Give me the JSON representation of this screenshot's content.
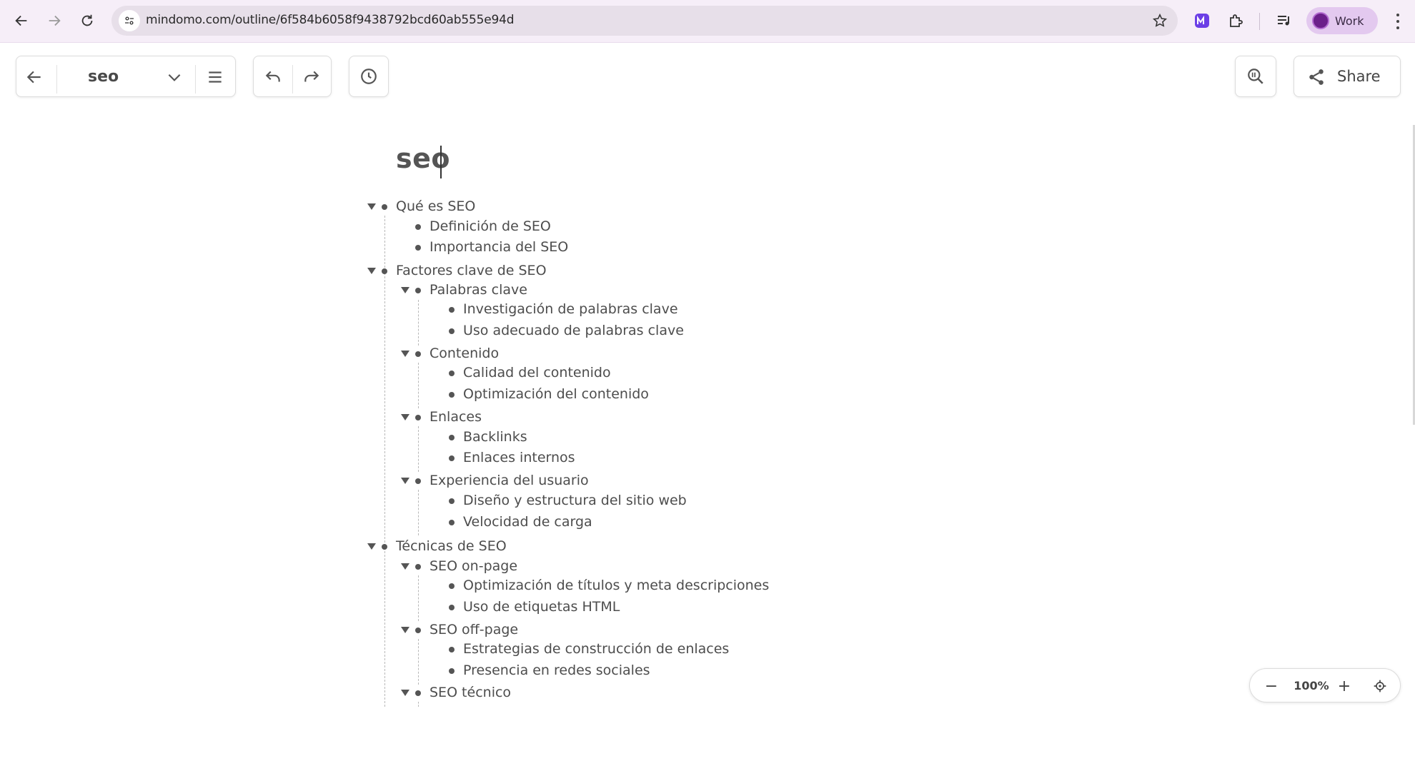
{
  "browser": {
    "url": "mindomo.com/outline/6f584b6058f9438792bcd60ab555e94d",
    "profile_label": "Work"
  },
  "toolbar": {
    "map_title": "seo",
    "share_label": "Share"
  },
  "outline": {
    "title": "seo",
    "items": [
      {
        "text": "Qué es SEO"
      },
      {
        "text": "Definición de SEO"
      },
      {
        "text": "Importancia del SEO"
      },
      {
        "text": "Factores clave de SEO"
      },
      {
        "text": "Palabras clave"
      },
      {
        "text": "Investigación de palabras clave"
      },
      {
        "text": "Uso adecuado de palabras clave"
      },
      {
        "text": "Contenido"
      },
      {
        "text": "Calidad del contenido"
      },
      {
        "text": "Optimización del contenido"
      },
      {
        "text": "Enlaces"
      },
      {
        "text": "Backlinks"
      },
      {
        "text": "Enlaces internos"
      },
      {
        "text": "Experiencia del usuario"
      },
      {
        "text": "Diseño y estructura del sitio web"
      },
      {
        "text": "Velocidad de carga"
      },
      {
        "text": "Técnicas de SEO"
      },
      {
        "text": "SEO on-page"
      },
      {
        "text": "Optimización de títulos y meta descripciones"
      },
      {
        "text": "Uso de etiquetas HTML"
      },
      {
        "text": "SEO off-page"
      },
      {
        "text": "Estrategias de construcción de enlaces"
      },
      {
        "text": "Presencia en redes sociales"
      },
      {
        "text": "SEO técnico"
      }
    ]
  },
  "zoom": {
    "level": "100%",
    "minus": "−",
    "plus": "+"
  }
}
